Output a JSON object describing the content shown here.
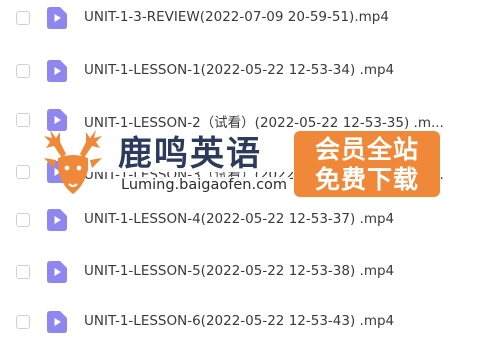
{
  "files": [
    {
      "name": "UNIT-1-3-REVIEW(2022-07-09 20-59-51).mp4"
    },
    {
      "name": "UNIT-1-LESSON-1(2022-05-22 12-53-34) .mp4"
    },
    {
      "name": "UNIT-1-LESSON-2（试看）(2022-05-22 12-53-35) .m..."
    },
    {
      "name": "UNIT-1-LESSON-3（试看）(2022-05-22 12-53-36) .m..."
    },
    {
      "name": "UNIT-1-LESSON-4(2022-05-22 12-53-37) .mp4"
    },
    {
      "name": "UNIT-1-LESSON-5(2022-05-22 12-53-38) .mp4"
    },
    {
      "name": "UNIT-1-LESSON-6(2022-05-22 12-53-43) .mp4"
    }
  ],
  "watermark": {
    "title": "鹿鸣英语",
    "url": "Luming.baigaofen.com",
    "badge_line1": "会员全站",
    "badge_line2": "免费下载"
  },
  "colors": {
    "video_icon": "#8f86f0",
    "checkbox_border": "#cfcfd4",
    "text": "#3a3a3a",
    "brand_orange": "#f0883a",
    "brand_navy": "#2c3a5c"
  },
  "icons": {
    "file": "video-file-icon",
    "logo": "deer-logo-icon"
  }
}
